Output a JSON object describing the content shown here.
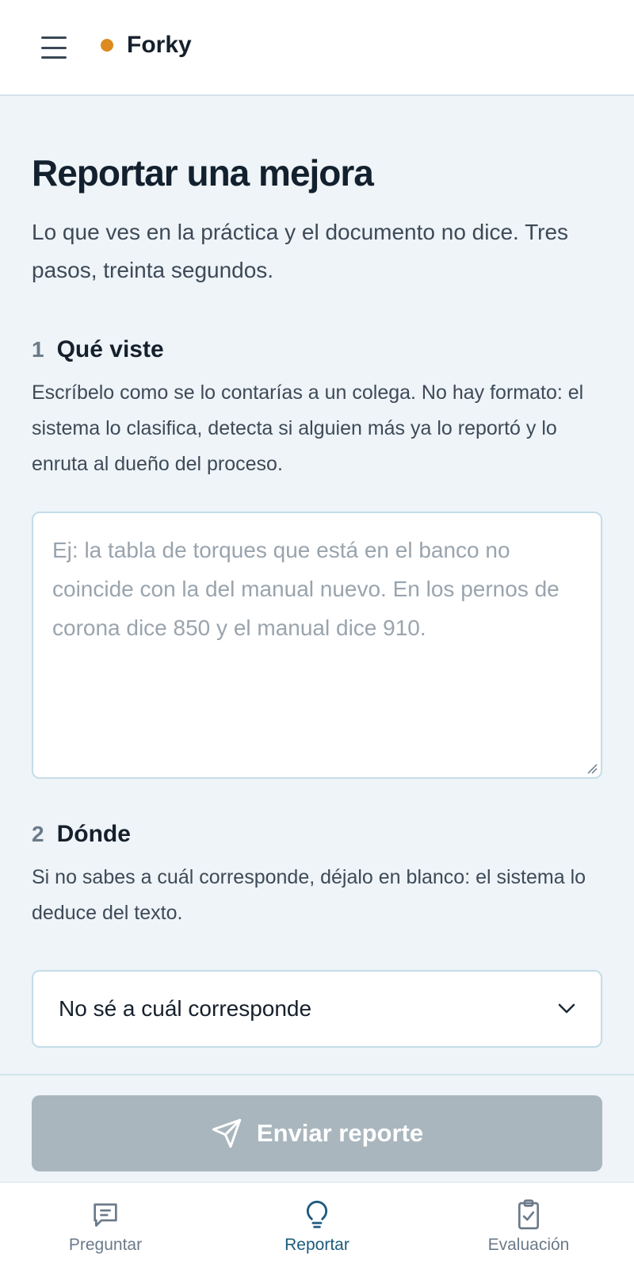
{
  "header": {
    "brand": "Forky",
    "brand_color": "#dc8a1f",
    "menu_icon": "hamburger-menu-icon"
  },
  "page": {
    "title": "Reportar una mejora",
    "subtitle": "Lo que ves en la práctica y el documento no dice. Tres pasos, treinta segundos."
  },
  "step1": {
    "number": "1",
    "title": "Qué viste",
    "description": "Escríbelo como se lo contarías a un colega. No hay formato: el sistema lo clasifica, detecta si alguien más ya lo reportó y lo enruta al dueño del proceso.",
    "placeholder": "Ej: la tabla de torques que está en el banco no coincide con la del manual nuevo. En los pernos de corona dice 850 y el manual dice 910.",
    "value": ""
  },
  "step2": {
    "number": "2",
    "title": "Dónde",
    "description": "Si no sabes a cuál corresponde, déjalo en blanco: el sistema lo deduce del texto.",
    "selected": "No sé a cuál corresponde"
  },
  "actions": {
    "send_label": "Enviar reporte",
    "send_icon": "paper-plane-icon",
    "disabled_color": "#a9b6be"
  },
  "tabs": [
    {
      "label": "Preguntar",
      "icon": "chat-message-icon",
      "active": false
    },
    {
      "label": "Reportar",
      "icon": "lightbulb-icon",
      "active": true
    },
    {
      "label": "Evaluación",
      "icon": "clipboard-check-icon",
      "active": false
    }
  ]
}
